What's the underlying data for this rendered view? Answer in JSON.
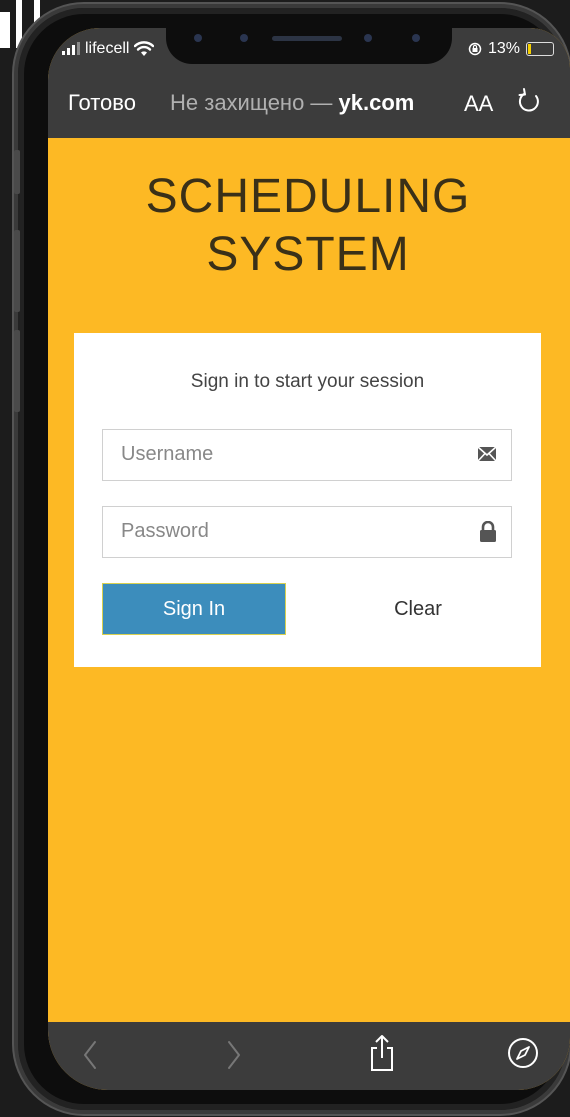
{
  "status_bar": {
    "carrier": "lifecell",
    "battery_text": "13%",
    "battery_level": 0.13,
    "icons": [
      "signal-bars-icon",
      "wifi-icon",
      "orientation-lock-icon",
      "battery-icon"
    ]
  },
  "browser": {
    "done_label": "Готово",
    "url_prefix": "Не захищено — ",
    "url_domain": "yk.com",
    "text_size_label": "AA",
    "icons": [
      "reload-icon",
      "back-icon",
      "forward-icon",
      "share-icon",
      "compass-icon"
    ]
  },
  "page": {
    "title_line1": "SCHEDULING",
    "title_line2": "SYSTEM",
    "login_message": "Sign in to start your session",
    "username_placeholder": "Username",
    "password_placeholder": "Password",
    "sign_in_label": "Sign In",
    "clear_label": "Clear",
    "icons": [
      "envelope-icon",
      "lock-icon"
    ]
  },
  "colors": {
    "page_background": "#fdb924",
    "browser_chrome": "#3c3c3c",
    "sign_in_button": "#3c8dbc",
    "title_text": "#3a3018"
  }
}
